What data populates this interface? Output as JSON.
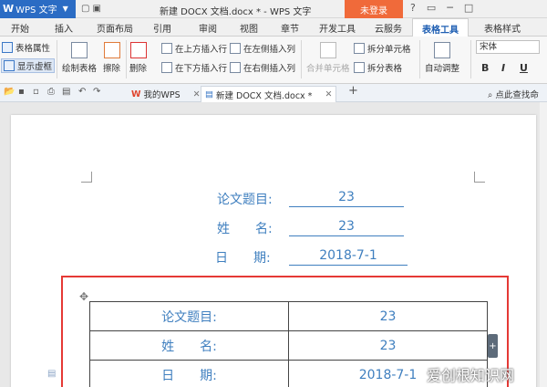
{
  "titlebar": {
    "app_name": "WPS 文字",
    "doc_title": "新建 DOCX 文档.docx * - WPS 文字",
    "login": "未登录"
  },
  "tabs": [
    "开始",
    "插入",
    "页面布局",
    "引用",
    "审阅",
    "视图",
    "章节",
    "开发工具",
    "云服务",
    "表格工具",
    "表格样式"
  ],
  "active_tab": "表格工具",
  "ribbon": {
    "table_props": "表格属性",
    "show_gridlines": "显示虚框",
    "draw_table": "绘制表格",
    "erase": "擦除",
    "delete": "删除",
    "insert_above": "在上方插入行",
    "insert_below": "在下方插入行",
    "insert_left": "在左侧插入列",
    "insert_right": "在右侧插入列",
    "merge_cells": "合并单元格",
    "split_cells": "拆分单元格",
    "split_table": "拆分表格",
    "auto_adjust": "自动调整",
    "font": "宋体",
    "bold": "B",
    "italic": "I",
    "underline": "U"
  },
  "doc_tabs": {
    "my_wps": "我的WPS",
    "current": "新建 DOCX 文档.docx *",
    "search_cmd": "点此查找命令"
  },
  "document": {
    "fields": [
      {
        "label": "论文题目:",
        "value": "23"
      },
      {
        "label": "姓　　名:",
        "value": "23"
      },
      {
        "label": "日　　期:",
        "value": "2018-7-1"
      }
    ],
    "table_rows": [
      {
        "label": "论文题目:",
        "value": "23"
      },
      {
        "label": "姓　　名:",
        "value": "23"
      },
      {
        "label": "日　　期:",
        "value": "2018-7-1"
      }
    ]
  },
  "watermark": "爱创根知识网"
}
